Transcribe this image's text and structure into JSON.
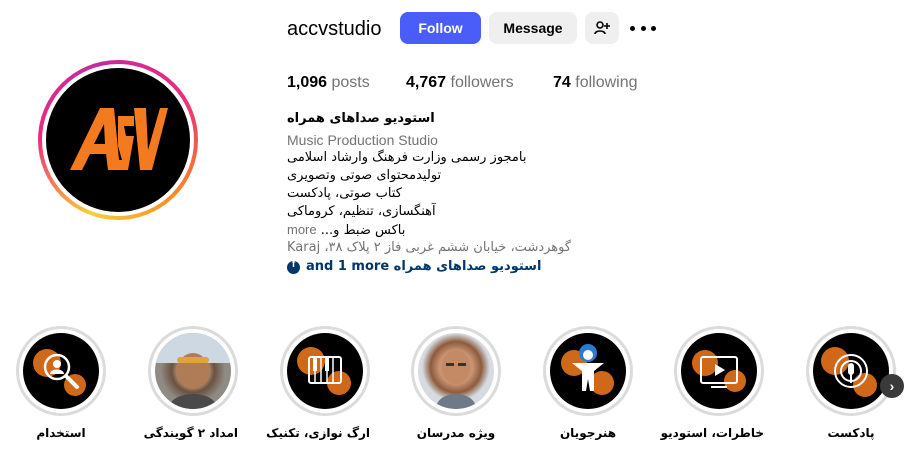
{
  "profile": {
    "username": "accvstudio",
    "follow_label": "Follow",
    "message_label": "Message",
    "add_user_icon": "person-plus-icon",
    "more_icon": "ellipsis-icon"
  },
  "stats": {
    "posts_count": "1,096",
    "posts_label": "posts",
    "followers_count": "4,767",
    "followers_label": "followers",
    "following_count": "74",
    "following_label": "following"
  },
  "bio": {
    "full_name": "استودیو صداهای همراه",
    "category": "Music Production Studio",
    "lines": [
      "بامجوز رسمی وزارت فرهنگ وارشاد اسلامی",
      "تولیدمحتوای صوتی وتصویری",
      "کتاب صوتی، پادکست",
      "آهنگسازی، تنظیم، کروماکی"
    ],
    "last_line": "باکس ضبط و...",
    "more_label": "more",
    "address": "گوهردشت، خیابان ششم غربی فاز ۲ پلاک ۳۸، Karaj",
    "links_text": "استودیو صداهای همراه and 1 more"
  },
  "highlights": [
    {
      "label": "پادکست",
      "icon": "microphone-icon"
    },
    {
      "label": "خاطرات، استودیو",
      "icon": "video-player-icon"
    },
    {
      "label": "هنرجویان",
      "icon": "student-icon"
    },
    {
      "label": "ویژه مدرسان",
      "icon": "teacher-photo"
    },
    {
      "label": "ارگ نوازی، تکنیک",
      "icon": "piano-icon"
    },
    {
      "label": "امداد ۲ گویندگی",
      "icon": "person-photo"
    },
    {
      "label": "استخدام",
      "icon": "search-person-icon"
    }
  ],
  "colors": {
    "brand_orange": "#f47a1f",
    "follow_blue": "#4a5df9",
    "link_blue": "#00376b"
  }
}
